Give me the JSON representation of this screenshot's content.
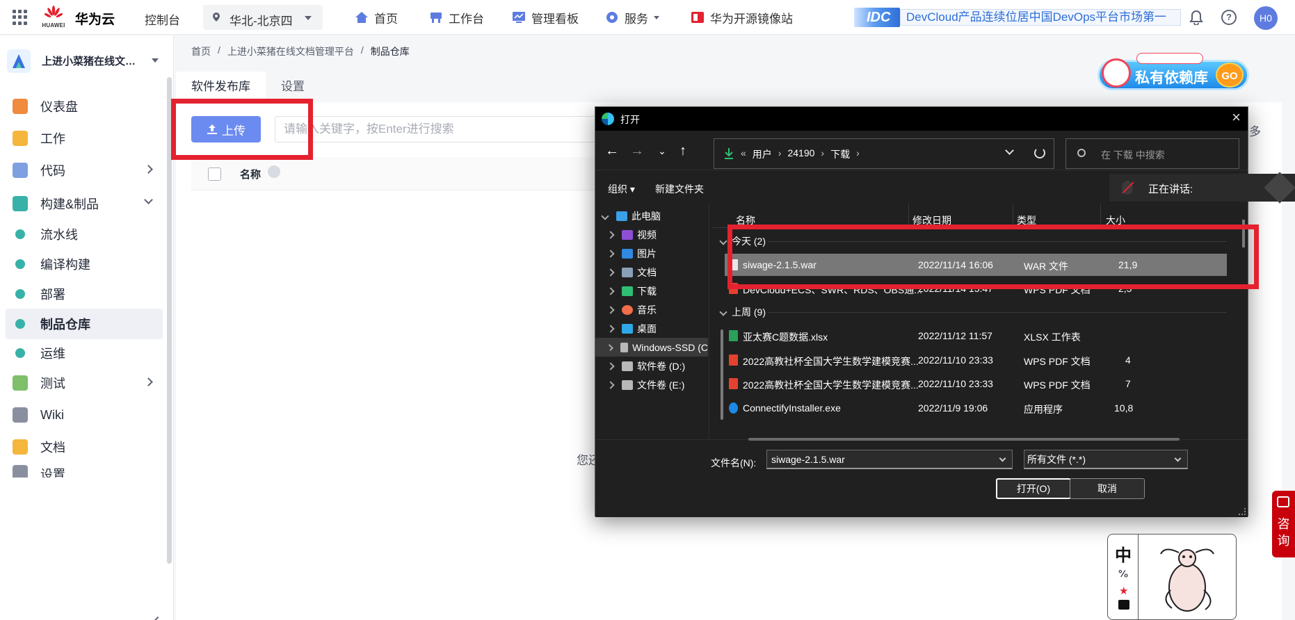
{
  "header": {
    "brand_word": "HUAWEI",
    "brand_name": "华为云",
    "console": "控制台",
    "region": "华北-北京四",
    "nav": [
      {
        "label": "首页",
        "icon": "home-icon"
      },
      {
        "label": "工作台",
        "icon": "workbench-icon"
      },
      {
        "label": "管理看板",
        "icon": "dashboard-icon"
      },
      {
        "label": "服务",
        "icon": "service-icon"
      },
      {
        "label": "华为开源镜像站",
        "icon": "mirror-icon"
      }
    ],
    "idc_logo": "IDC",
    "idc_banner": "DevCloud产品连续位居中国DevOps平台市场第一",
    "avatar": "H0",
    "help": "?"
  },
  "sidebar": {
    "project": "上进小菜猪在线文档管理平台",
    "items": [
      {
        "label": "仪表盘",
        "icon": "dashboard-icon",
        "color": "#f08a3e"
      },
      {
        "label": "工作",
        "icon": "work-icon",
        "color": "#f5b63d"
      },
      {
        "label": "代码",
        "icon": "code-icon",
        "color": "#7ea0e0"
      },
      {
        "label": "构建&制品",
        "icon": "build-icon",
        "color": "#38b2a8"
      },
      {
        "label": "流水线",
        "icon": "pipeline-icon",
        "color": "#38b2a8"
      },
      {
        "label": "编译构建",
        "icon": "compile-icon",
        "color": "#38b2a8"
      },
      {
        "label": "部署",
        "icon": "deploy-icon",
        "color": "#38b2a8"
      },
      {
        "label": "制品仓库",
        "icon": "artifact-icon",
        "color": "#38b2a8"
      },
      {
        "label": "运维",
        "icon": "ops-icon",
        "color": "#38b2a8"
      },
      {
        "label": "测试",
        "icon": "test-icon",
        "color": "#7ebf6a"
      },
      {
        "label": "Wiki",
        "icon": "wiki-icon",
        "color": "#8a8fa0"
      },
      {
        "label": "文档",
        "icon": "docs-icon",
        "color": "#f5b63d"
      },
      {
        "label": "设置",
        "icon": "settings-icon",
        "color": "#8a8fa0"
      }
    ]
  },
  "main": {
    "breadcrumb": [
      "首页",
      "上进小菜猪在线文档管理平台",
      "制品仓库"
    ],
    "tabs": [
      "软件发布库",
      "设置"
    ],
    "upload_label": "上传",
    "search_placeholder": "请输入关键字，按Enter进行搜索",
    "column_name": "名称",
    "empty_hint": "您还",
    "more": "多"
  },
  "promo": {
    "text": "私有依赖库",
    "go": "GO"
  },
  "dialog": {
    "title": "打开",
    "path": [
      "用户",
      "24190",
      "下载"
    ],
    "path_prefix": "«",
    "search_placeholder": "在 下载 中搜索",
    "organize": "组织",
    "new_folder": "新建文件夹",
    "tree": [
      {
        "label": "此电脑",
        "icon": "pc-icon",
        "color": "#3aa0e8",
        "open": true
      },
      {
        "label": "视频",
        "icon": "video-icon",
        "color": "#8e4fd6"
      },
      {
        "label": "图片",
        "icon": "picture-icon",
        "color": "#2f8ae0"
      },
      {
        "label": "文档",
        "icon": "document-icon",
        "color": "#8aa0b8"
      },
      {
        "label": "下载",
        "icon": "download-icon",
        "color": "#2fbf72"
      },
      {
        "label": "音乐",
        "icon": "music-icon",
        "color": "#f26d4a"
      },
      {
        "label": "桌面",
        "icon": "desktop-icon",
        "color": "#2ea8e8"
      },
      {
        "label": "Windows-SSD (C",
        "icon": "drive-icon",
        "color": "#b8b8b8"
      },
      {
        "label": "软件卷 (D:)",
        "icon": "drive-icon",
        "color": "#b8b8b8"
      },
      {
        "label": "文件卷 (E:)",
        "icon": "drive-icon",
        "color": "#b8b8b8"
      }
    ],
    "columns": [
      "名称",
      "修改日期",
      "类型",
      "大小"
    ],
    "groups": [
      {
        "label": "今天 (2)",
        "files": [
          {
            "name": "siwage-2.1.5.war",
            "date": "2022/11/14 16:06",
            "type": "WAR 文件",
            "size": "21,9",
            "icon": "file-icon",
            "color": "#e8e8e8"
          },
          {
            "name": "DevCloud+ECS、SWR、RDS、OBS通...",
            "date": "2022/11/14 15:47",
            "type": "WPS PDF 文档",
            "size": "2,5",
            "icon": "pdf-icon",
            "color": "#e4412f"
          }
        ]
      },
      {
        "label": "上周 (9)",
        "files": [
          {
            "name": "亚太赛C题数据.xlsx",
            "date": "2022/11/12 11:57",
            "type": "XLSX 工作表",
            "size": "",
            "icon": "excel-icon",
            "color": "#2aa05a"
          },
          {
            "name": "2022高教社杯全国大学生数学建模竞赛...",
            "date": "2022/11/10 23:33",
            "type": "WPS PDF 文档",
            "size": "4",
            "icon": "pdf-icon",
            "color": "#e4412f"
          },
          {
            "name": "2022高教社杯全国大学生数学建模竞赛...",
            "date": "2022/11/10 23:33",
            "type": "WPS PDF 文档",
            "size": "7",
            "icon": "pdf-icon",
            "color": "#e4412f"
          },
          {
            "name": "ConnectifyInstaller.exe",
            "date": "2022/11/9 19:06",
            "type": "应用程序",
            "size": "10,8",
            "icon": "wifi-icon",
            "color": "#1e88e5"
          }
        ]
      }
    ],
    "filename_label": "文件名(N):",
    "filename_value": "siwage-2.1.5.war",
    "filetype_value": "所有文件 (*.*)",
    "open_button": "打开(O)",
    "cancel_button": "取消"
  },
  "voice": {
    "text": "正在讲话:"
  },
  "consult": {
    "text": "咨询"
  },
  "mascot": {
    "char": "中"
  }
}
